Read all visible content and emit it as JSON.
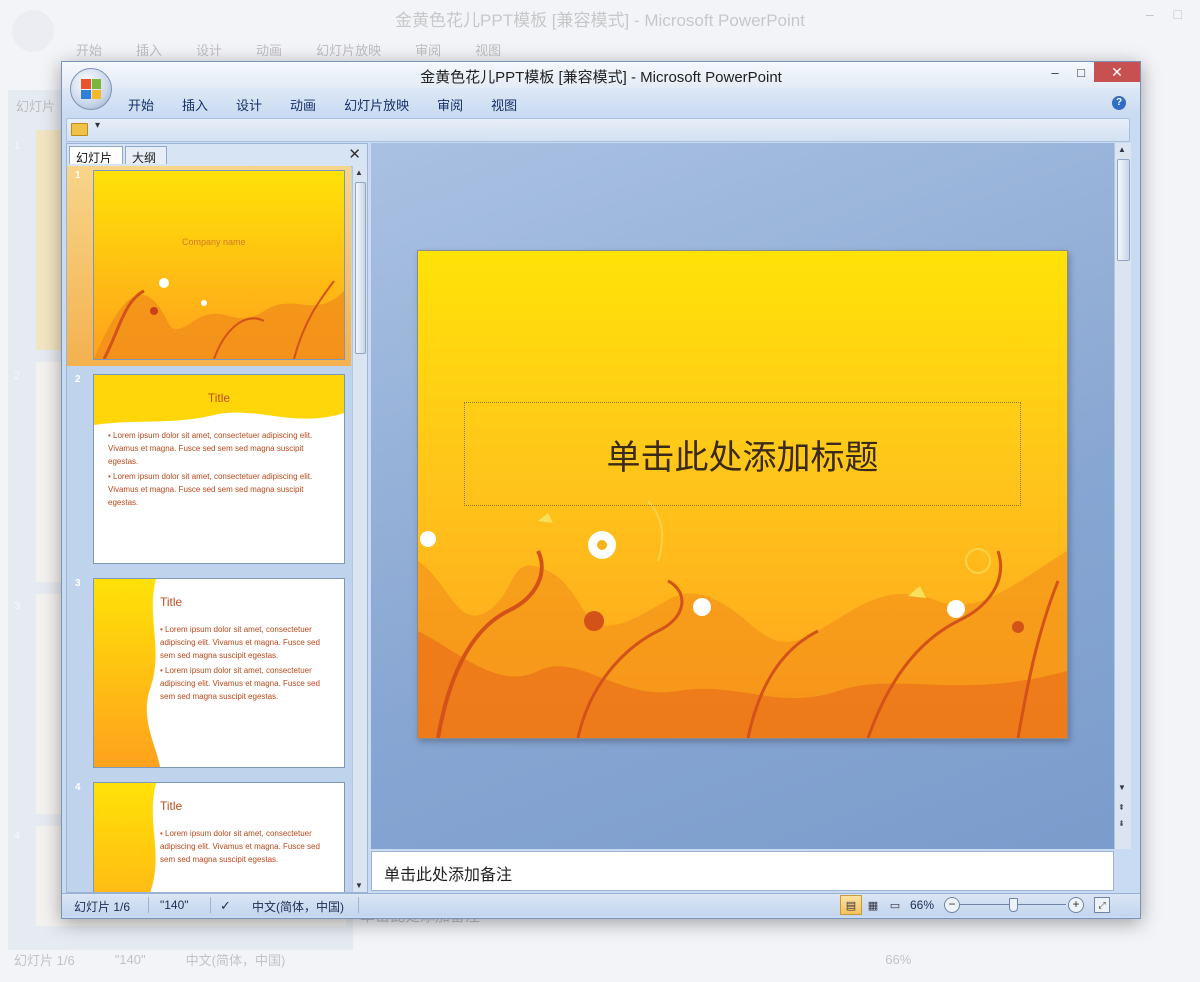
{
  "window": {
    "title": "金黄色花儿PPT模板 [兼容模式] - Microsoft PowerPoint",
    "controls": {
      "minimize": "–",
      "maximize": "□",
      "close": "✕"
    }
  },
  "menu": {
    "items": [
      "开始",
      "插入",
      "设计",
      "动画",
      "幻灯片放映",
      "审阅",
      "视图"
    ],
    "help": "?"
  },
  "quick_access": {
    "more": "▾"
  },
  "left_pane": {
    "tabs": {
      "slides": "幻灯片",
      "outline": "大纲"
    },
    "close": "✕",
    "slides": [
      {
        "number": "1",
        "subtitle": "Company name",
        "selected": true
      },
      {
        "number": "2",
        "title": "Title",
        "bullets": [
          "Lorem ipsum dolor sit amet, consectetuer adipiscing elit. Vivamus et magna. Fusce sed sem sed magna suscipit egestas.",
          "Lorem ipsum dolor sit amet, consectetuer adipiscing elit. Vivamus et magna. Fusce sed sem sed magna suscipit egestas."
        ]
      },
      {
        "number": "3",
        "title": "Title",
        "bullets": [
          "Lorem ipsum dolor sit amet, consectetuer adipiscing elit. Vivamus et magna. Fusce sed sem sed magna suscipit egestas.",
          "Lorem ipsum dolor sit amet, consectetuer adipiscing elit. Vivamus et magna. Fusce sed sem sed magna suscipit egestas."
        ]
      },
      {
        "number": "4",
        "title": "Title",
        "bullets": [
          "Lorem ipsum dolor sit amet, consectetuer adipiscing elit. Vivamus et magna. Fusce sed sem sed magna suscipit egestas."
        ]
      }
    ]
  },
  "slide": {
    "title_placeholder": "单击此处添加标题",
    "colors": {
      "top": "#ffe207",
      "bottom": "#ffa11d",
      "floral": "#e05a1a",
      "flower_white": "#ffffff"
    }
  },
  "notes": {
    "placeholder": "单击此处添加备注"
  },
  "status": {
    "slide_info": "幻灯片 1/6",
    "theme": "\"140\"",
    "language": "中文(简体，中国)",
    "zoom": "66%",
    "zoom_minus": "−",
    "zoom_plus": "+",
    "zoom_level": 0.5
  },
  "background_window": {
    "title": "金黄色花儿PPT模板 [兼容模式] - Microsoft PowerPoint",
    "menu": [
      "开始",
      "插入",
      "设计",
      "动画",
      "幻灯片放映",
      "审阅",
      "视图"
    ],
    "slides_tab": "幻灯片",
    "slide_numbers": [
      "1",
      "2",
      "3",
      "4"
    ],
    "status": [
      "幻灯片 1/6",
      "\"140\"",
      "中文(简体，中国)",
      "66%"
    ],
    "notes": "单击此处添加备注",
    "thumb_text": "sed magna suscipit egestas."
  }
}
